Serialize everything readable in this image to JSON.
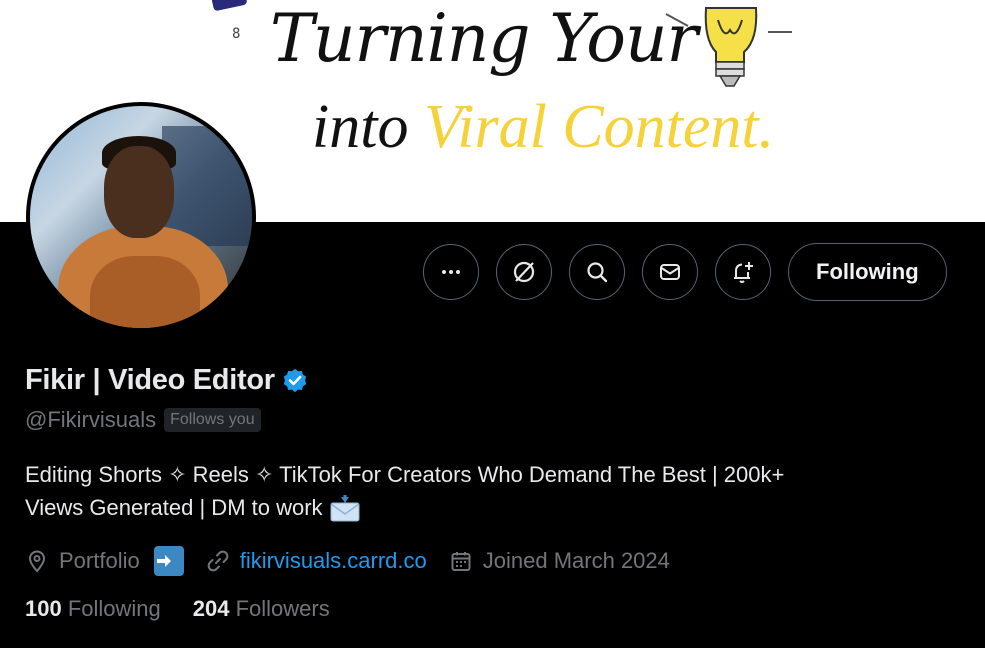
{
  "banner": {
    "line1": "Turning Your",
    "line2_word1": "into ",
    "line2_word2": "Viral Content."
  },
  "actions": {
    "more_icon": "more-icon",
    "grok_icon": "grok-icon",
    "search_icon": "search-icon",
    "message_icon": "message-icon",
    "notify_icon": "notification-bell-plus-icon",
    "follow_label": "Following"
  },
  "profile": {
    "name": "Fikir | Video Editor",
    "handle": "@Fikirvisuals",
    "follows_you": "Follows you",
    "bio_line1": "Editing Shorts ✧ Reels ✧ TikTok For Creators Who Demand The Best | 200k+",
    "bio_line2": "Views Generated | DM to work ",
    "location": "Portfolio",
    "website": "fikirvisuals.carrd.co",
    "joined": "Joined March 2024",
    "following_count": "100",
    "following_label": " Following",
    "followers_count": "204",
    "followers_label": " Followers"
  },
  "colors": {
    "background": "#000000",
    "link": "#1d9bf0",
    "verified": "#1d9bf0",
    "secondary_text": "#71767b",
    "highlight": "#f5d23a"
  }
}
